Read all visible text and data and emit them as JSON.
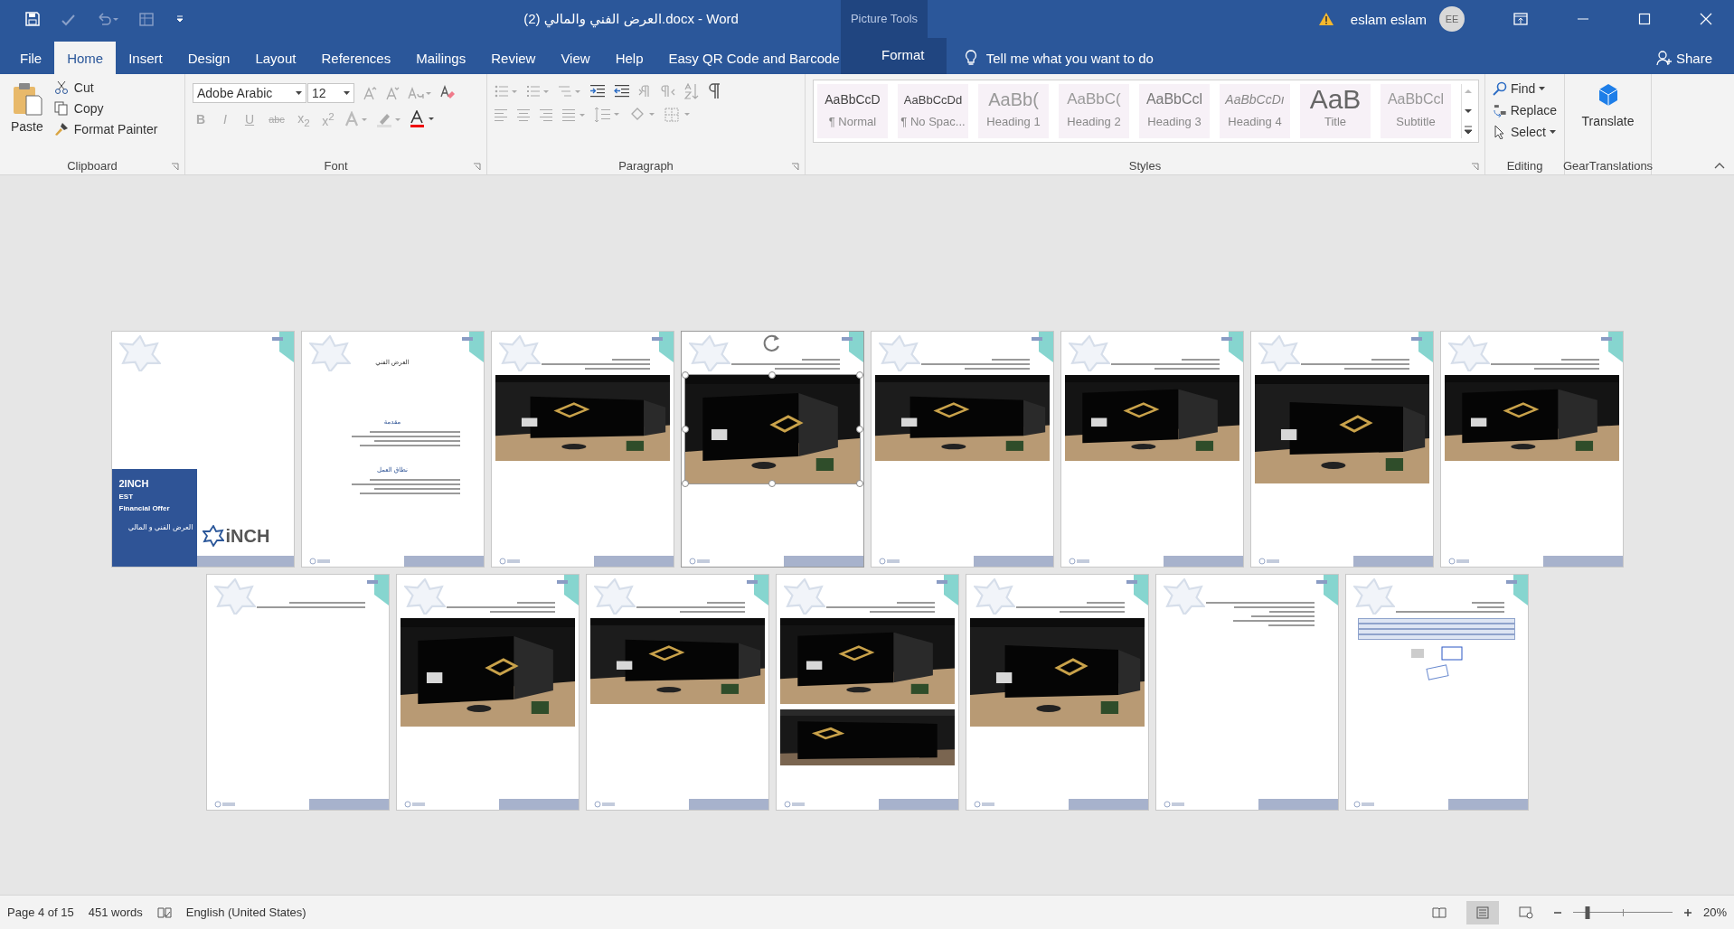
{
  "window": {
    "title": "العرض الفني والمالي (2).docx  -  Word",
    "contextual_tab_group": "Picture Tools",
    "user": "eslam eslam",
    "avatar": "EE"
  },
  "tabs": [
    {
      "label": "File",
      "selected": false
    },
    {
      "label": "Home",
      "selected": true
    },
    {
      "label": "Insert",
      "selected": false
    },
    {
      "label": "Design",
      "selected": false
    },
    {
      "label": "Layout",
      "selected": false
    },
    {
      "label": "References",
      "selected": false
    },
    {
      "label": "Mailings",
      "selected": false
    },
    {
      "label": "Review",
      "selected": false
    },
    {
      "label": "View",
      "selected": false
    },
    {
      "label": "Help",
      "selected": false
    },
    {
      "label": "Easy QR Code and Barcode",
      "selected": false
    },
    {
      "label": "Format",
      "selected": false
    }
  ],
  "tell_me": "Tell me what you want to do",
  "share": "Share",
  "clipboard": {
    "paste": "Paste",
    "items": [
      "Cut",
      "Copy",
      "Format Painter"
    ],
    "label": "Clipboard"
  },
  "font": {
    "name": "Adobe Arabic",
    "size": "12",
    "label": "Font",
    "format_buttons": [
      {
        "label": "B",
        "disabled": true
      },
      {
        "label": "I",
        "disabled": true
      },
      {
        "label": "U",
        "disabled": true
      },
      {
        "label": "abc",
        "disabled": true
      },
      {
        "label": "x$_{2}$",
        "disabled": true
      },
      {
        "label": "x$^{2}$",
        "disabled": true
      }
    ]
  },
  "paragraph": {
    "label": "Paragraph"
  },
  "styles": {
    "label": "Styles",
    "items": [
      {
        "preview": "AaBbCcD",
        "name": "¶ Normal",
        "kind": "normal"
      },
      {
        "preview": "AaBbCcDd",
        "name": "¶ No Spac...",
        "kind": "small"
      },
      {
        "preview": "AaBb(",
        "name": "Heading 1",
        "kind": "heading1"
      },
      {
        "preview": "AaBbC(",
        "name": "Heading 2",
        "kind": "heading2"
      },
      {
        "preview": "AaBbCcl",
        "name": "Heading 3",
        "kind": "heading3"
      },
      {
        "preview": "AaBbCcDı",
        "name": "Heading 4",
        "kind": "heading4"
      },
      {
        "preview": "AaB",
        "name": "Title",
        "kind": "title"
      },
      {
        "preview": "AaBbCcl",
        "name": "Subtitle",
        "kind": "subtitle"
      }
    ]
  },
  "editing": {
    "label": "Editing",
    "items": [
      {
        "label": "Find",
        "kind": "find"
      },
      {
        "label": "Replace",
        "kind": "replace"
      },
      {
        "label": "Select",
        "kind": "select"
      }
    ]
  },
  "translations": {
    "button": "Translate",
    "label": "GearTranslations"
  },
  "pages": [
    {
      "kind": "cover",
      "selected": false,
      "texts": [
        "2INCH",
        "EST",
        "Financial Offer",
        "العرض الفني و المالي"
      ],
      "logo": "iNCH"
    },
    {
      "kind": "text",
      "selected": false,
      "title": "العرض الفني",
      "headings": [
        "مقدمة",
        "نطاق العمل"
      ]
    },
    {
      "kind": "picture",
      "selected": false
    },
    {
      "kind": "picture",
      "selected": true
    },
    {
      "kind": "picture",
      "selected": false
    },
    {
      "kind": "picture",
      "selected": false
    },
    {
      "kind": "picture",
      "selected": false
    },
    {
      "kind": "picture",
      "selected": false
    },
    {
      "kind": "blank",
      "selected": false
    },
    {
      "kind": "picture",
      "selected": false
    },
    {
      "kind": "picture",
      "selected": false
    },
    {
      "kind": "two-pictures",
      "selected": false
    },
    {
      "kind": "picture",
      "selected": false
    },
    {
      "kind": "text",
      "selected": false
    },
    {
      "kind": "table",
      "selected": false
    }
  ],
  "status_bar": {
    "page": "Page 4 of 15",
    "words": "451 words",
    "language": "English (United States)",
    "views": [
      {
        "kind": "read",
        "selected": false
      },
      {
        "kind": "print",
        "selected": true
      },
      {
        "kind": "web",
        "selected": false
      }
    ],
    "zoom": {
      "level": 0.15,
      "reading": "20%"
    }
  }
}
